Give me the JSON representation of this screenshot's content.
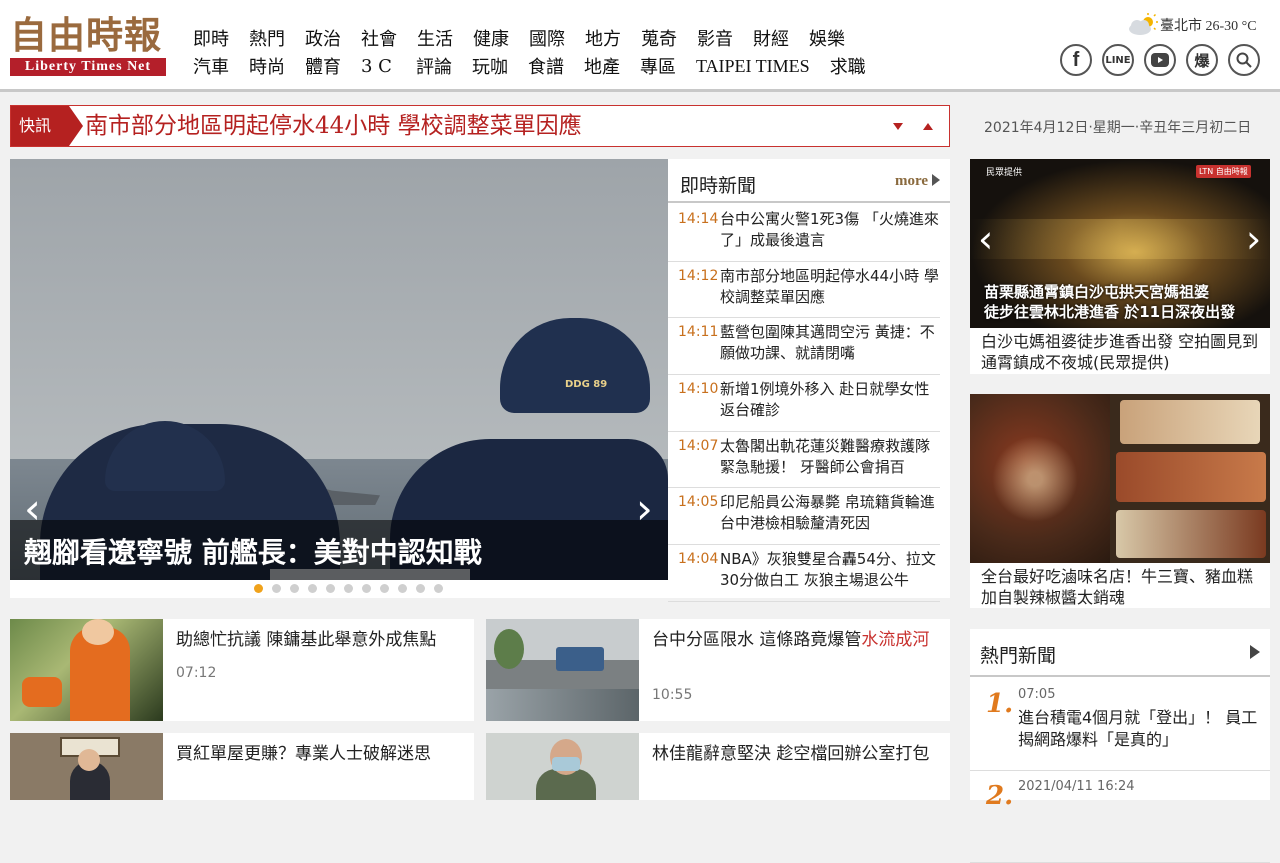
{
  "header": {
    "logo_cn": "自由時報",
    "logo_en": "Liberty Times Net",
    "nav_row1": [
      "即時",
      "熱門",
      "政治",
      "社會",
      "生活",
      "健康",
      "國際",
      "地方",
      "蒐奇",
      "影音",
      "財經",
      "娛樂"
    ],
    "nav_row2": [
      "汽車",
      "時尚",
      "體育",
      "3 C",
      "評論",
      "玩咖",
      "食譜",
      "地產",
      "專區",
      "TAIPEI TIMES",
      "求職"
    ],
    "weather": "臺北市 26-30 °C",
    "social": {
      "facebook": "f",
      "line": "LINE",
      "youtube": "▶",
      "baoliao": "爆",
      "search": ""
    }
  },
  "breaking": {
    "tag": "快訊",
    "text": "南市部分地區明起停水44小時 學校調整菜單因應"
  },
  "date": "2021年4月12日‧星期一‧辛丑年三月初二日",
  "hero": {
    "caption": "翹腳看遼寧號 前艦長：美對中認知戰",
    "cap_text": "DDG 89",
    "prev": "‹",
    "next": "›",
    "slide_count": 11,
    "active_slide": 0
  },
  "instant": {
    "title": "即時新聞",
    "more": "more",
    "items": [
      {
        "time": "14:14",
        "headline": "台中公寓火警1死3傷 「火燒進來了」成最後遺言"
      },
      {
        "time": "14:12",
        "headline": "南市部分地區明起停水44小時 學校調整菜單因應"
      },
      {
        "time": "14:11",
        "headline": "藍營包圍陳其邁問空污 黃捷：不願做功課、就請閉嘴"
      },
      {
        "time": "14:10",
        "headline": "新增1例境外移入 赴日就學女性返台確診"
      },
      {
        "time": "14:07",
        "headline": "太魯閣出軌花蓮災難醫療救護隊緊急馳援！ 牙醫師公會捐百"
      },
      {
        "time": "14:05",
        "headline": "印尼船員公海暴斃 帛琉籍貨輪進台中港檢相驗釐清死因"
      },
      {
        "time": "14:04",
        "headline": "NBA》灰狼雙星合轟54分、拉文30分做白工 灰狼主場退公牛"
      }
    ]
  },
  "cards": [
    {
      "headline": "助總忙抗議 陳鏞基此舉意外成焦點",
      "headline_red": "",
      "time": "07:12"
    },
    {
      "headline": "台中分區限水 這條路竟爆管",
      "headline_red": "水流成河",
      "time": "10:55"
    },
    {
      "headline": "買紅單屋更賺？專業人士破解迷思",
      "headline_red": "",
      "time": ""
    },
    {
      "headline": "林佳龍辭意堅決 趁空檔回辦公室打包",
      "headline_red": "",
      "time": ""
    }
  ],
  "side": {
    "video1": {
      "credit": "民眾提供",
      "badge": "LTN 自由時報",
      "overlay_line1": "苗栗縣通霄鎮白沙屯拱天宮媽祖婆",
      "overlay_line2": "徒步往雲林北港進香 於11日深夜出發",
      "caption": "白沙屯媽祖婆徒步進香出發 空拍圖見到通霄鎮成不夜城(民眾提供)"
    },
    "story2": {
      "caption": "全台最好吃滷味名店！牛三寶、豬血糕加自製辣椒醬太銷魂"
    }
  },
  "hot": {
    "title": "熱門新聞",
    "items": [
      {
        "rank": "1.",
        "time": "07:05",
        "headline": "進台積電4個月就「登出」！ 員工揭網路爆料「是真的」"
      },
      {
        "rank": "2.",
        "time": "2021/04/11 16:24",
        "headline": ""
      }
    ]
  },
  "colors": {
    "brand_red": "#b41f2a",
    "logo_brown": "#9a6a3e",
    "time_orange": "#c8701d",
    "rank_orange": "#e07a1e"
  }
}
